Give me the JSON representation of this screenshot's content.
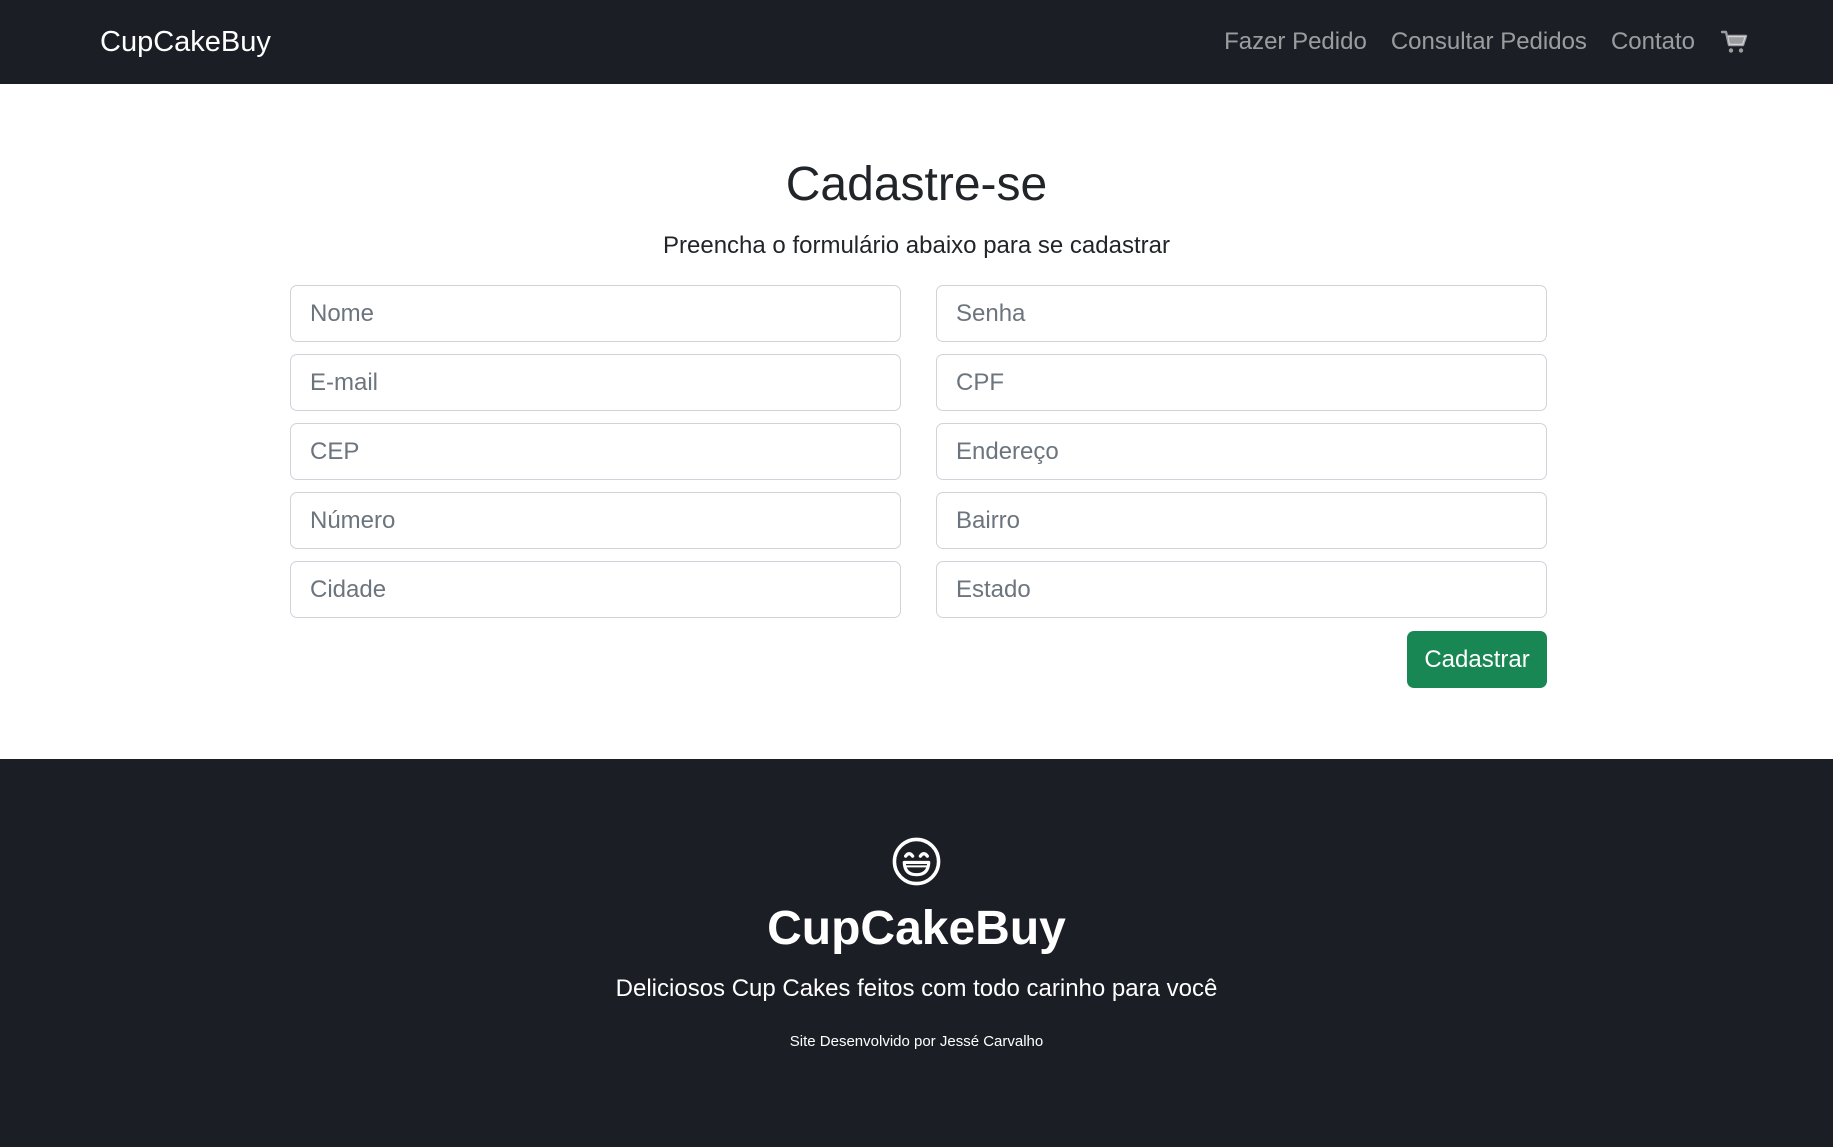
{
  "navbar": {
    "brand": "CupCakeBuy",
    "links": [
      {
        "label": "Fazer Pedido"
      },
      {
        "label": "Consultar Pedidos"
      },
      {
        "label": "Contato"
      }
    ],
    "cart_icon": "cart-icon"
  },
  "form": {
    "title": "Cadastre-se",
    "subtitle": "Preencha o formulário abaixo para se cadastrar",
    "fields": {
      "nome": {
        "placeholder": "Nome",
        "value": ""
      },
      "senha": {
        "placeholder": "Senha",
        "value": ""
      },
      "email": {
        "placeholder": "E-mail",
        "value": ""
      },
      "cpf": {
        "placeholder": "CPF",
        "value": ""
      },
      "cep": {
        "placeholder": "CEP",
        "value": ""
      },
      "endereco": {
        "placeholder": "Endereço",
        "value": ""
      },
      "numero": {
        "placeholder": "Número",
        "value": ""
      },
      "bairro": {
        "placeholder": "Bairro",
        "value": ""
      },
      "cidade": {
        "placeholder": "Cidade",
        "value": ""
      },
      "estado": {
        "placeholder": "Estado",
        "value": ""
      }
    },
    "submit_label": "Cadastrar"
  },
  "footer": {
    "icon": "smiley-icon",
    "brand": "CupCakeBuy",
    "tagline": "Deliciosos Cup Cakes feitos com todo carinho para você",
    "credit": "Site Desenvolvido por Jessé Carvalho"
  },
  "colors": {
    "dark_background": "#1b1f25",
    "success_button": "#198754",
    "input_border": "#ced4da",
    "placeholder_text": "#6c757d",
    "body_text": "#212529"
  }
}
